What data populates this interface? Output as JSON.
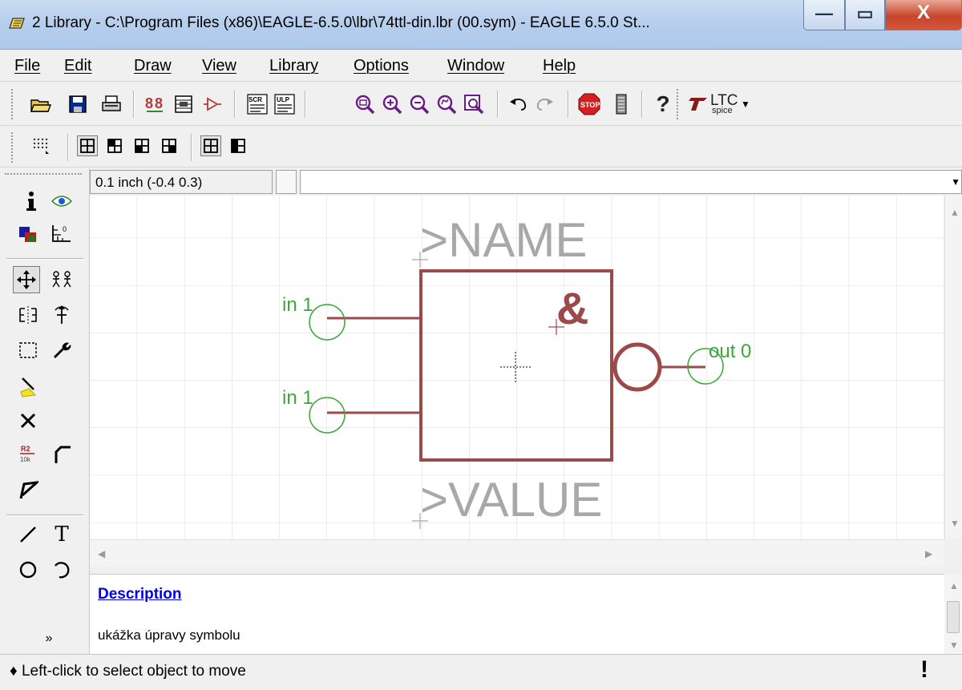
{
  "window": {
    "title": "2 Library - C:\\Program Files (x86)\\EAGLE-6.5.0\\lbr\\74ttl-din.lbr (00.sym) - EAGLE 6.5.0 St...",
    "minimize_glyph": "—",
    "maximize_glyph": "▭",
    "close_glyph": "X"
  },
  "menu": {
    "items": [
      {
        "label": "File"
      },
      {
        "label": "Edit"
      },
      {
        "label": "Draw"
      },
      {
        "label": "View"
      },
      {
        "label": "Library"
      },
      {
        "label": "Options"
      },
      {
        "label": "Window"
      },
      {
        "label": "Help"
      }
    ]
  },
  "toolbar": {
    "ltc_label": "LTC",
    "spice_label": "spice",
    "scr_label": "SCR",
    "ulp_label": "ULP",
    "stop_label": "STOP",
    "help_glyph": "?",
    "icons": [
      "open-icon",
      "save-icon",
      "print-icon",
      "cam-icon",
      "board-icon",
      "schematic-icon",
      "script-icon",
      "ulp-icon",
      "zoom-fit-icon",
      "zoom-in-icon",
      "zoom-out-icon",
      "zoom-redraw-icon",
      "zoom-select-icon",
      "undo-icon",
      "redo-icon",
      "stop-icon",
      "go-icon",
      "help-icon",
      "ltspice-icon"
    ]
  },
  "command": {
    "coordinates": "0.1 inch (-0.4 0.3)",
    "input_value": ""
  },
  "palette": {
    "text_tool_glyph": "T",
    "r2_label": "R2",
    "r2_value": "10k"
  },
  "symbol": {
    "name_placeholder": ">NAME",
    "value_placeholder": ">VALUE",
    "gate_symbol": "&",
    "pins": [
      {
        "label": "in 1"
      },
      {
        "label": "in 1"
      },
      {
        "label": "out 0"
      }
    ],
    "colors": {
      "body": "#9b4a4a",
      "pin": "#3aa83a",
      "placeholder_text": "#a8a8a8",
      "grid": "#d9d9d9"
    }
  },
  "description": {
    "title": "Description",
    "text": "ukážka úpravy symbolu"
  },
  "status": {
    "text": "♦ Left-click to select object to move",
    "indicator": "!"
  }
}
